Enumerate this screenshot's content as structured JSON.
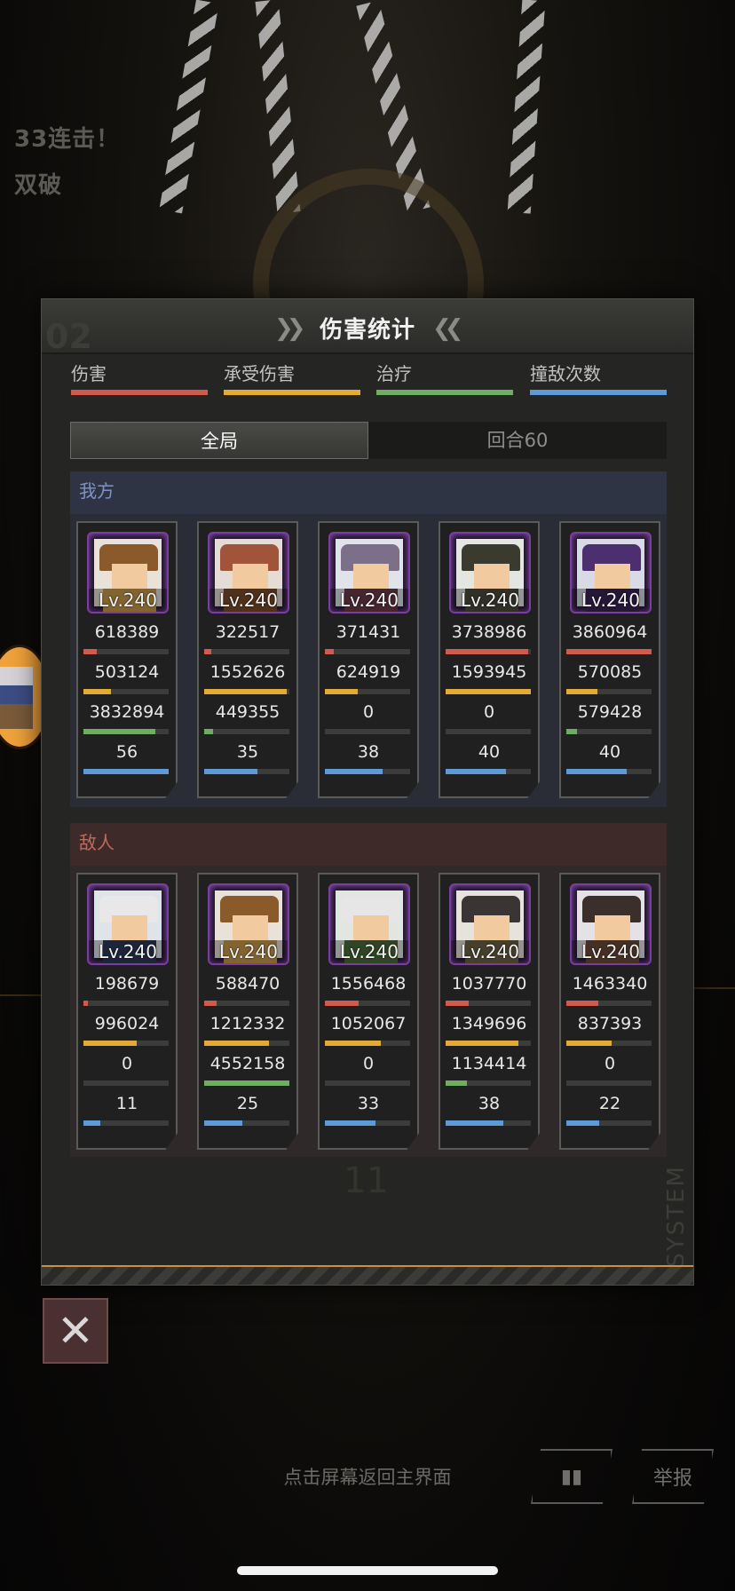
{
  "background": {
    "combo_line1": "33连击！",
    "combo_line2": "双破"
  },
  "panel": {
    "title": "伤害统计",
    "bg_number": "02",
    "legend": [
      {
        "label": "伤害",
        "color": "#d05a4c"
      },
      {
        "label": "承受伤害",
        "color": "#e3ab35"
      },
      {
        "label": "治疗",
        "color": "#6fae62"
      },
      {
        "label": "撞敌次数",
        "color": "#5f9ad8"
      }
    ],
    "tabs": {
      "active": "全局",
      "inactive": "回合60"
    },
    "ally_label": "我方",
    "enemy_label": "敌人",
    "system_text": "SYSTEM",
    "ghost_number": "11"
  },
  "colors": {
    "damage": "#d05a4c",
    "taken": "#e3ab35",
    "heal": "#6fae62",
    "hits": "#5f9ad8"
  },
  "allies": [
    {
      "level": "Lv.240",
      "damage": "618389",
      "damage_frac": 0.16,
      "taken": "503124",
      "taken_frac": 0.32,
      "heal": "3832894",
      "heal_frac": 0.84,
      "hits": "56",
      "hits_frac": 1.0,
      "hair": "#8b5a2b",
      "outfit": "#c89a4c",
      "bgcol": "#e8e2d8"
    },
    {
      "level": "Lv.240",
      "damage": "322517",
      "damage_frac": 0.08,
      "taken": "1552626",
      "taken_frac": 0.97,
      "heal": "449355",
      "heal_frac": 0.1,
      "hits": "35",
      "hits_frac": 0.62,
      "hair": "#a0553a",
      "outfit": "#7a4a2a",
      "bgcol": "#e6dcd6"
    },
    {
      "level": "Lv.240",
      "damage": "371431",
      "damage_frac": 0.1,
      "taken": "624919",
      "taken_frac": 0.39,
      "heal": "0",
      "heal_frac": 0.0,
      "hits": "38",
      "hits_frac": 0.68,
      "hair": "#7b6f8a",
      "outfit": "#6a3a4a",
      "bgcol": "#e0e3ea"
    },
    {
      "level": "Lv.240",
      "damage": "3738986",
      "damage_frac": 0.97,
      "taken": "1593945",
      "taken_frac": 1.0,
      "heal": "0",
      "heal_frac": 0.0,
      "hits": "40",
      "hits_frac": 0.71,
      "hair": "#3a3a2e",
      "outfit": "#4a4a3c",
      "bgcol": "#e4e6e2"
    },
    {
      "level": "Lv.240",
      "damage": "3860964",
      "damage_frac": 1.0,
      "taken": "570085",
      "taken_frac": 0.36,
      "heal": "579428",
      "heal_frac": 0.13,
      "hits": "40",
      "hits_frac": 0.71,
      "hair": "#4b2f6e",
      "outfit": "#3a2456",
      "bgcol": "#d8dbe6"
    }
  ],
  "enemies": [
    {
      "level": "Lv.240",
      "damage": "198679",
      "damage_frac": 0.05,
      "taken": "996024",
      "taken_frac": 0.62,
      "heal": "0",
      "heal_frac": 0.0,
      "hits": "11",
      "hits_frac": 0.2,
      "hair": "#e8e8e8",
      "outfit": "#2d3a5a",
      "bgcol": "#dfe3ea"
    },
    {
      "level": "Lv.240",
      "damage": "588470",
      "damage_frac": 0.15,
      "taken": "1212332",
      "taken_frac": 0.76,
      "heal": "4552158",
      "heal_frac": 1.0,
      "hits": "25",
      "hits_frac": 0.45,
      "hair": "#8b5a2b",
      "outfit": "#c89a4c",
      "bgcol": "#e8e2d8"
    },
    {
      "level": "Lv.240",
      "damage": "1556468",
      "damage_frac": 0.4,
      "taken": "1052067",
      "taken_frac": 0.66,
      "heal": "0",
      "heal_frac": 0.0,
      "hits": "33",
      "hits_frac": 0.59,
      "hair": "#e6e6e6",
      "outfit": "#4a6a3a",
      "bgcol": "#e2e6e0"
    },
    {
      "level": "Lv.240",
      "damage": "1037770",
      "damage_frac": 0.27,
      "taken": "1349696",
      "taken_frac": 0.85,
      "heal": "1134414",
      "heal_frac": 0.25,
      "hits": "38",
      "hits_frac": 0.68,
      "hair": "#3a3434",
      "outfit": "#6a6244",
      "bgcol": "#e6e2dc"
    },
    {
      "level": "Lv.240",
      "damage": "1463340",
      "damage_frac": 0.38,
      "taken": "837393",
      "taken_frac": 0.53,
      "heal": "0",
      "heal_frac": 0.0,
      "hits": "22",
      "hits_frac": 0.39,
      "hair": "#3a2f2a",
      "outfit": "#6a4a3a",
      "bgcol": "#e4e2e6"
    }
  ],
  "footer": {
    "hint": "点击屏幕返回主界面",
    "report_label": "举报"
  }
}
